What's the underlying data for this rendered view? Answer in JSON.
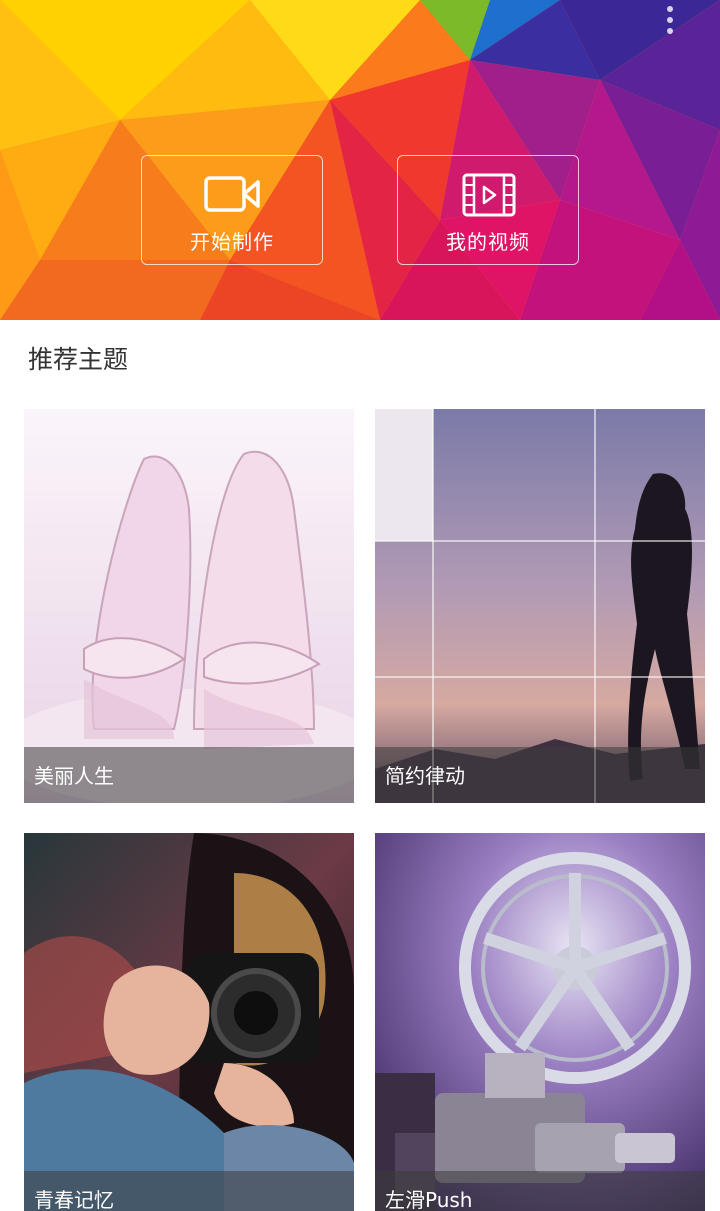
{
  "header": {
    "start_button": {
      "label": "开始制作",
      "icon": "video-camera-icon"
    },
    "videos_button": {
      "label": "我的视频",
      "icon": "film-play-icon"
    },
    "menu_icon": "more-vertical-icon"
  },
  "section": {
    "title": "推荐主题"
  },
  "themes": [
    {
      "label": "美丽人生"
    },
    {
      "label": "简约律动"
    },
    {
      "label": "青春记忆"
    },
    {
      "label": "左滑Push"
    }
  ],
  "colors": {
    "accent_orange": "#f78c1e",
    "accent_magenta": "#d9137a",
    "accent_purple": "#6a1a95"
  }
}
